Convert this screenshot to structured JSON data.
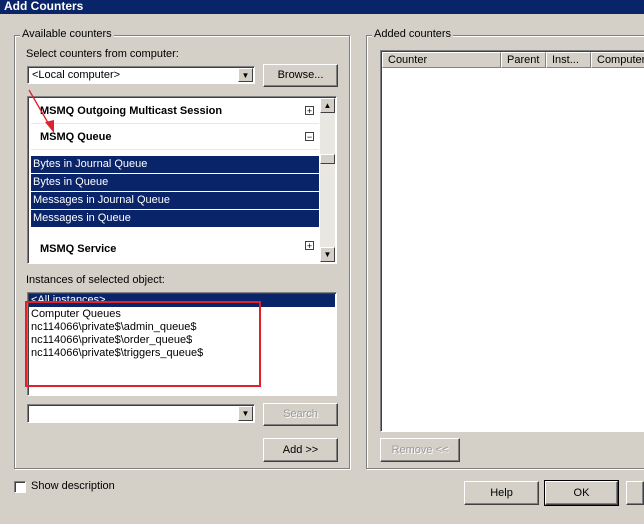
{
  "window": {
    "title": "Add Counters"
  },
  "available": {
    "group_label": "Available counters",
    "computer_label": "Select counters from computer:",
    "computer_value": "<Local computer>",
    "browse_button": "Browse...",
    "categories": [
      {
        "label": "MSMQ Outgoing Multicast Session",
        "expander": "+"
      },
      {
        "label": "MSMQ Queue",
        "expander": "−"
      },
      {
        "label": "MSMQ Service",
        "expander": "+"
      }
    ],
    "selected_counters": [
      "Bytes in Journal Queue",
      "Bytes in Queue",
      "Messages in Journal Queue",
      "Messages in Queue"
    ],
    "instances_label": "Instances of selected object:",
    "instances": [
      "<All instances>",
      "Computer Queues",
      "nc114066\\private$\\admin_queue$",
      "nc114066\\private$\\order_queue$",
      "nc114066\\private$\\triggers_queue$"
    ],
    "search_value": "",
    "search_button": "Search",
    "add_button": "Add >>"
  },
  "added": {
    "group_label": "Added counters",
    "columns": [
      "Counter",
      "Parent",
      "Inst...",
      "Computer"
    ],
    "remove_button": "Remove <<"
  },
  "footer": {
    "show_description": "Show description",
    "show_description_checked": false,
    "help_button": "Help",
    "ok_button": "OK"
  },
  "colors": {
    "selection": "#0a246a",
    "annotation": "#e0202a",
    "dialog_bg": "#d4d0c8"
  }
}
